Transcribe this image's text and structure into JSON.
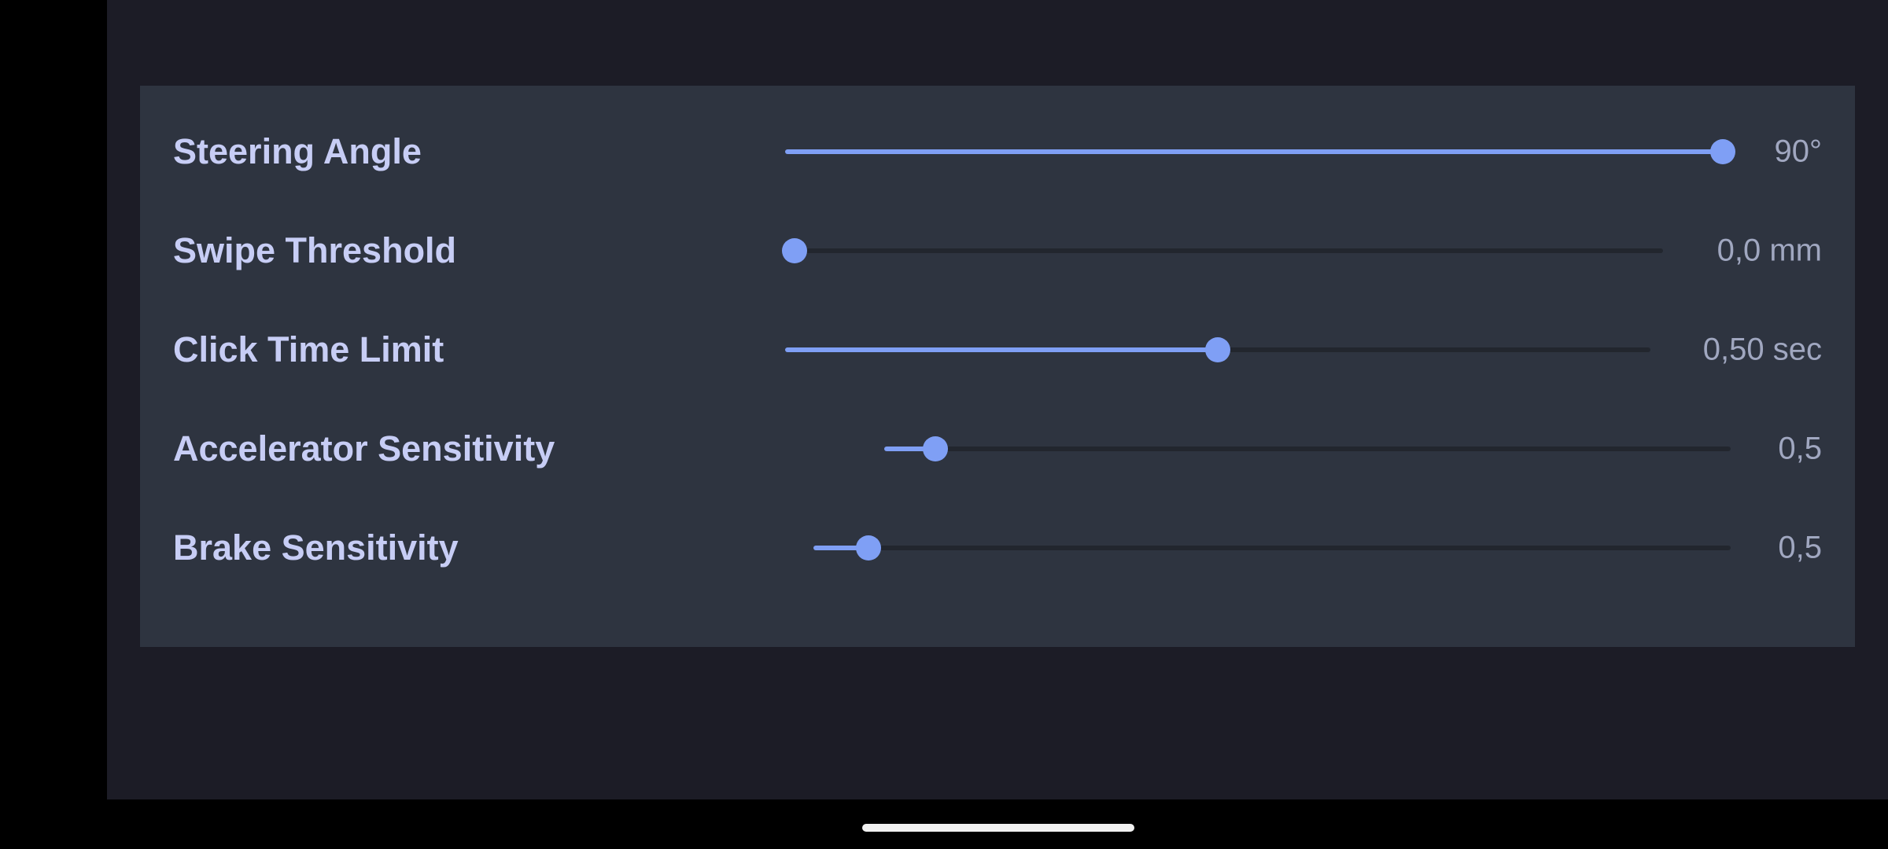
{
  "settings": [
    {
      "label": "Steering Angle",
      "value": "90°",
      "level": 1.0
    },
    {
      "label": "Swipe Threshold",
      "value": "0,0 mm",
      "level": 0.0
    },
    {
      "label": "Click Time Limit",
      "value": "0,50 sec",
      "level": 0.5
    },
    {
      "label": "Accelerator Sensitivity",
      "value": "0,5",
      "level": 0.06
    },
    {
      "label": "Brake Sensitivity",
      "value": "0,5",
      "level": 0.06
    }
  ],
  "colors": {
    "panel_background": "#2e3440",
    "app_background": "#1c1c26",
    "accent": "#7f9ff5",
    "label_text": "#c7cdf5",
    "value_text": "#a0a7c0",
    "track_inactive": "#22262e"
  }
}
